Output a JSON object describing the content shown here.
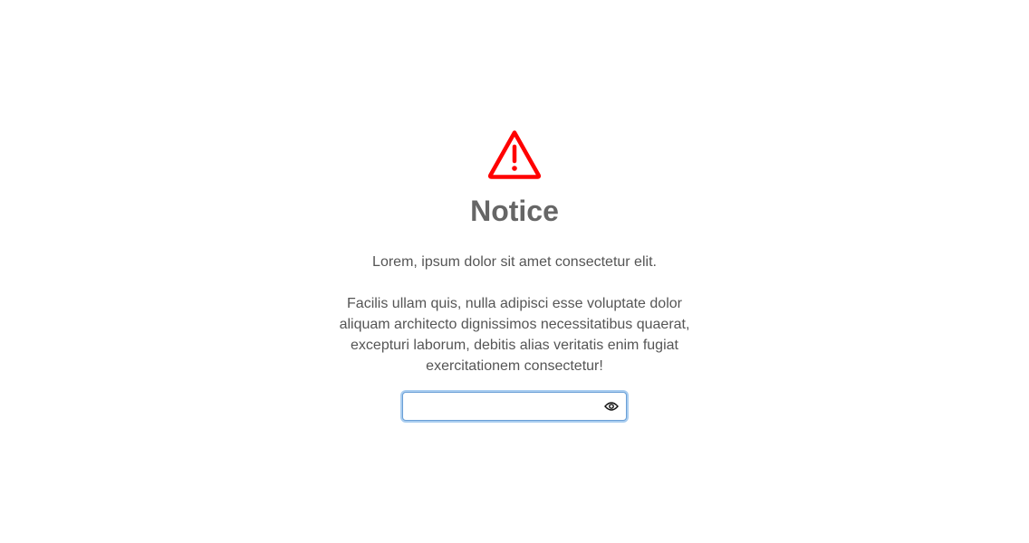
{
  "notice": {
    "icon": "warning-triangle-icon",
    "icon_color": "#ff0000",
    "title": "Notice",
    "paragraphs": [
      "Lorem, ipsum dolor sit amet consectetur elit.",
      "Facilis ullam quis, nulla adipisci esse voluptate dolor aliquam architecto dignissimos necessitatibus quaerat, excepturi laborum, debitis alias veritatis enim fugiat exercitationem consectetur!"
    ],
    "password_field": {
      "value": "",
      "placeholder": "",
      "toggle_icon": "eye-icon"
    }
  }
}
